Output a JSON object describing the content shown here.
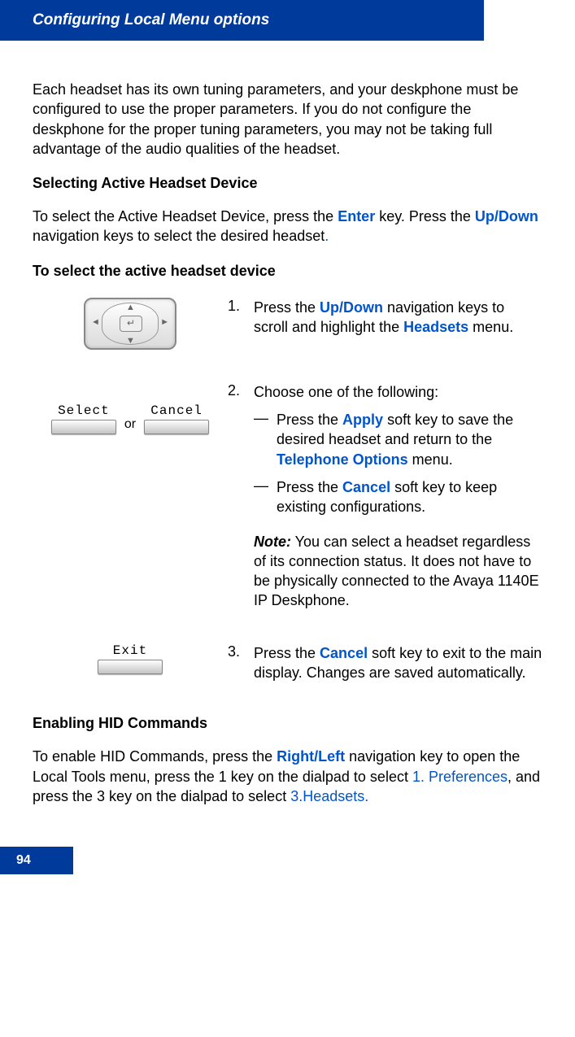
{
  "header": {
    "title": "Configuring Local Menu options"
  },
  "intro": "Each headset has its own tuning parameters, and your deskphone must be configured to use the proper parameters. If you do not configure the deskphone for the proper tuning parameters, you may not be taking full advantage of the audio qualities of the headset.",
  "section1": {
    "title": "Selecting Active Headset Device",
    "lead_pre": "To select the Active Headset Device, press the ",
    "enter": "Enter",
    "lead_mid": " key. Press the ",
    "updown": "Up/Down",
    "lead_post": " navigation keys to select the desired headset",
    "period": "."
  },
  "section2_title": "To select the active headset device",
  "softkeys": {
    "select": "Select",
    "cancel": "Cancel",
    "exit": "Exit",
    "or": "or"
  },
  "step1": {
    "num": "1.",
    "pre": "Press the ",
    "updown": "Up/Down",
    "mid": " navigation keys to scroll and highlight the ",
    "headsets": "Headsets",
    "post": " menu."
  },
  "step2": {
    "num": "2.",
    "intro": "Choose one of the following:",
    "dash": "—",
    "a_pre": "Press the ",
    "apply": "Apply",
    "a_mid": " soft key to save the desired headset and return to the ",
    "telopts": "Telephone Options",
    "a_post": " menu.",
    "b_pre": "Press the ",
    "cancel": "Cancel",
    "b_post": " soft key to keep existing configurations.",
    "note_label": "Note:",
    "note_body": " You can select a headset regardless of its connection status. It does not have to be physically connected to the Avaya 1140E IP Deskphone."
  },
  "step3": {
    "num": "3.",
    "pre": "Press the ",
    "cancel": "Cancel",
    "post": " soft key to exit to the main display. Changes are saved automatically."
  },
  "section3": {
    "title": "Enabling HID Commands",
    "pre": "To enable HID Commands, press the ",
    "rl": "Right/Left",
    "mid1": " navigation key to open the Local Tools menu, press the 1 key on the dialpad to select ",
    "pref": "1. Preferences",
    "mid2": ", and press the 3 key on the dialpad to select ",
    "hs": "3.Headsets."
  },
  "pagenum": "94"
}
